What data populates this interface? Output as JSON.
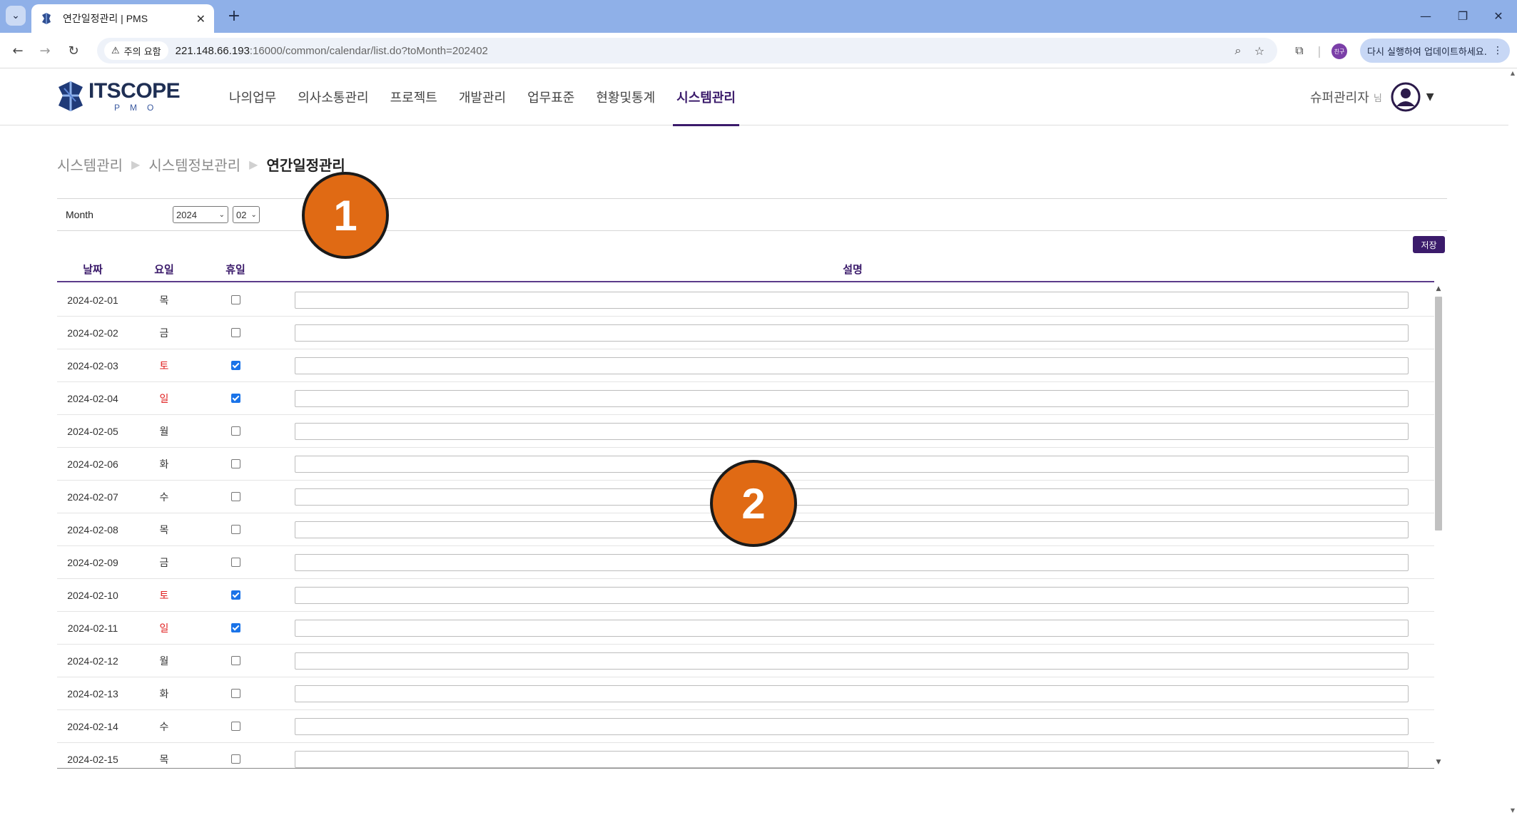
{
  "browser": {
    "tab_title": "연간일정관리 | PMS",
    "security_label": "주의 요함",
    "url_host": "221.148.66.193",
    "url_rest": ":16000/common/calendar/list.do?toMonth=202402",
    "profile_badge": "친구",
    "update_label": "다시 실행하여 업데이트하세요."
  },
  "header": {
    "logo_main": "ITSCOPE",
    "logo_sub": "PMO",
    "nav": [
      "나의업무",
      "의사소통관리",
      "프로젝트",
      "개발관리",
      "업무표준",
      "현황및통계",
      "시스템관리"
    ],
    "active_nav": "시스템관리",
    "user_name": "슈퍼관리자",
    "user_suffix": "님"
  },
  "breadcrumb": [
    "시스템관리",
    "시스템정보관리",
    "연간일정관리"
  ],
  "filter": {
    "label": "Month",
    "year": "2024",
    "month": "02"
  },
  "save_label": "저장",
  "table": {
    "headers": [
      "날짜",
      "요일",
      "휴일",
      "설명"
    ],
    "rows": [
      {
        "date": "2024-02-01",
        "day": "목",
        "holiday": false,
        "weekend": false
      },
      {
        "date": "2024-02-02",
        "day": "금",
        "holiday": false,
        "weekend": false
      },
      {
        "date": "2024-02-03",
        "day": "토",
        "holiday": true,
        "weekend": true
      },
      {
        "date": "2024-02-04",
        "day": "일",
        "holiday": true,
        "weekend": true
      },
      {
        "date": "2024-02-05",
        "day": "월",
        "holiday": false,
        "weekend": false
      },
      {
        "date": "2024-02-06",
        "day": "화",
        "holiday": false,
        "weekend": false
      },
      {
        "date": "2024-02-07",
        "day": "수",
        "holiday": false,
        "weekend": false
      },
      {
        "date": "2024-02-08",
        "day": "목",
        "holiday": false,
        "weekend": false
      },
      {
        "date": "2024-02-09",
        "day": "금",
        "holiday": false,
        "weekend": false
      },
      {
        "date": "2024-02-10",
        "day": "토",
        "holiday": true,
        "weekend": true
      },
      {
        "date": "2024-02-11",
        "day": "일",
        "holiday": true,
        "weekend": true
      },
      {
        "date": "2024-02-12",
        "day": "월",
        "holiday": false,
        "weekend": false
      },
      {
        "date": "2024-02-13",
        "day": "화",
        "holiday": false,
        "weekend": false
      },
      {
        "date": "2024-02-14",
        "day": "수",
        "holiday": false,
        "weekend": false
      },
      {
        "date": "2024-02-15",
        "day": "목",
        "holiday": false,
        "weekend": false
      }
    ]
  },
  "markers": [
    "1",
    "2"
  ],
  "colors": {
    "brand_purple": "#3b1b6b",
    "weekend_red": "#e02020",
    "checkbox_blue": "#1a73e8",
    "marker_orange": "#e06a14",
    "tabbar_blue": "#8fb0e8"
  }
}
